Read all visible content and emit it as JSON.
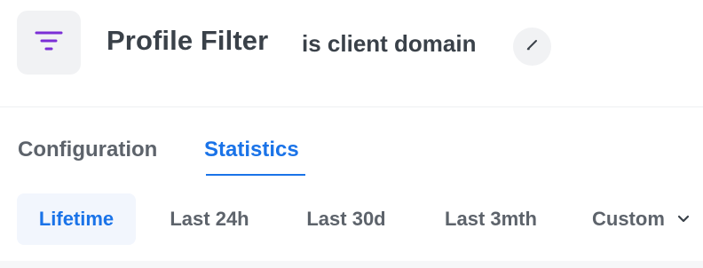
{
  "header": {
    "title": "Profile Filter",
    "subtitle": "is client domain",
    "icon": "filter-icon",
    "edit_icon": "pencil-icon"
  },
  "tabs": [
    {
      "label": "Configuration",
      "active": false
    },
    {
      "label": "Statistics",
      "active": true
    }
  ],
  "ranges": [
    {
      "label": "Lifetime",
      "active": true
    },
    {
      "label": "Last 24h",
      "active": false
    },
    {
      "label": "Last 30d",
      "active": false
    },
    {
      "label": "Last 3mth",
      "active": false
    },
    {
      "label": "Custom",
      "active": false,
      "icon": "chevron-down-icon"
    }
  ],
  "colors": {
    "accent": "#1a73e8",
    "filter_icon": "#7b2fd6",
    "text": "#3a4149",
    "muted": "#5d636b"
  }
}
